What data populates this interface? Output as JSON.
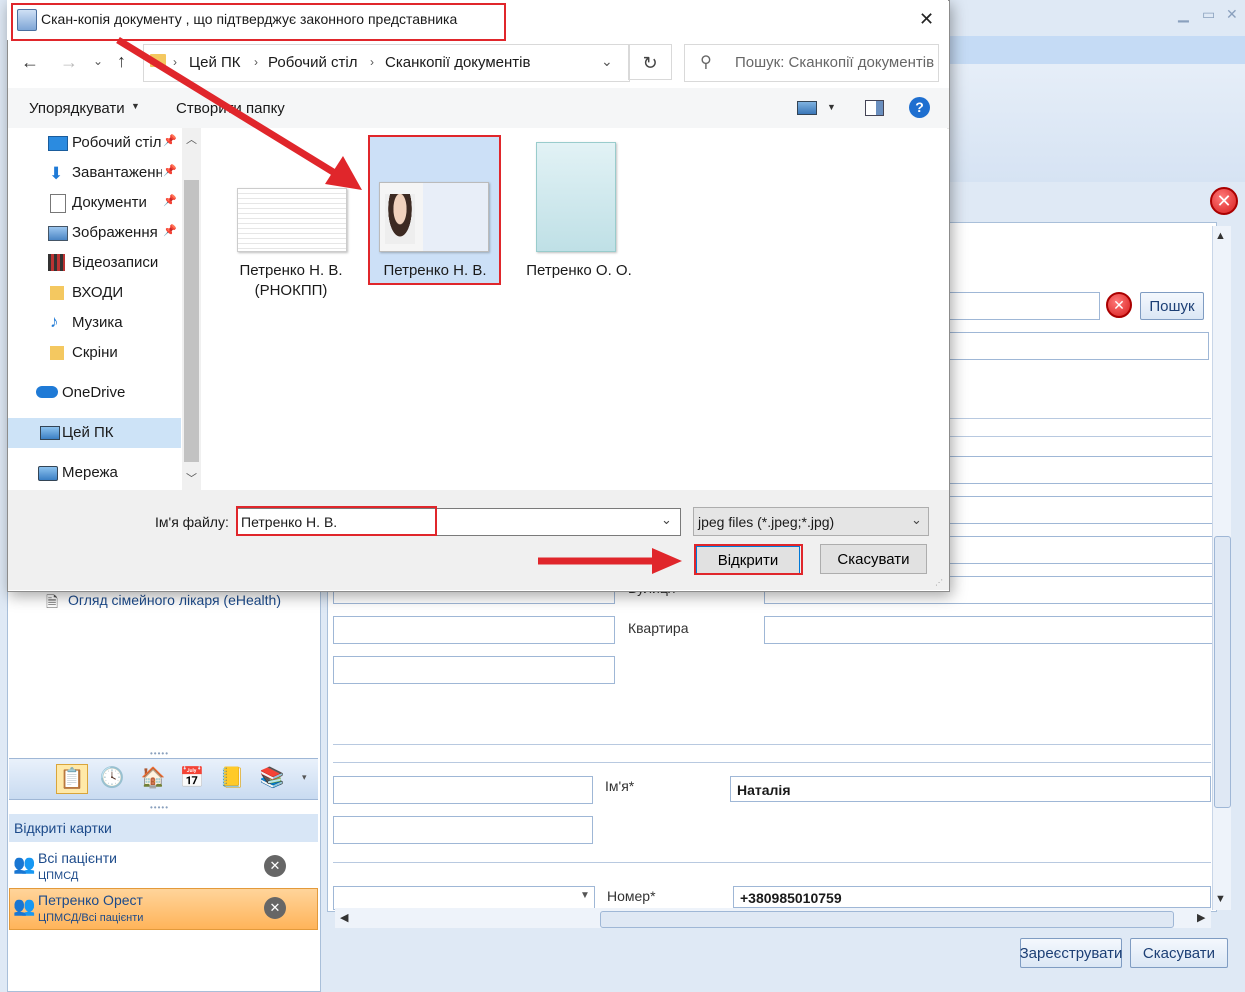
{
  "dialog": {
    "title": "Скан-копія документу , що підтверджує законного представника",
    "close_glyph": "✕",
    "breadcrumb": [
      "Цей ПК",
      "Робочий стіл",
      "Сканкопії документів"
    ],
    "search_placeholder": "Пошук: Сканкопії документів",
    "cmd": {
      "organize": "Упорядкувати",
      "new_folder": "Створити папку"
    },
    "nav": [
      {
        "label": "Робочий стіл",
        "icon": "desktop-icon",
        "pinned": true
      },
      {
        "label": "Завантаження",
        "icon": "download-icon",
        "pinned": true
      },
      {
        "label": "Документи",
        "icon": "documents-icon",
        "pinned": true
      },
      {
        "label": "Зображення",
        "icon": "pictures-icon",
        "pinned": true
      },
      {
        "label": "Відеозаписи",
        "icon": "videos-icon",
        "pinned": false
      },
      {
        "label": "ВХОДИ",
        "icon": "folder-icon",
        "pinned": false
      },
      {
        "label": "Музика",
        "icon": "music-icon",
        "pinned": false
      },
      {
        "label": "Скріни",
        "icon": "folder-icon",
        "pinned": false
      },
      {
        "label": "OneDrive",
        "icon": "cloud-icon",
        "pinned": false
      },
      {
        "label": "Цей ПК",
        "icon": "computer-icon",
        "pinned": false
      },
      {
        "label": "Мережа",
        "icon": "network-icon",
        "pinned": false
      }
    ],
    "files": [
      {
        "line1": "Петренко Н. В.",
        "line2": "(РНОКПП)"
      },
      {
        "line1": "Петренко Н. В.",
        "line2": ""
      },
      {
        "line1": "Петренко О. О.",
        "line2": ""
      }
    ],
    "filename_label": "Ім'я файлу:",
    "filename_value": "Петренко Н. В.",
    "filetype_value": "jpeg files (*.jpeg;*.jpg)",
    "open_button": "Відкрити",
    "cancel_button": "Скасувати"
  },
  "app": {
    "search_button": "Пошук",
    "tree_item": "Огляд сімейного лікаря (eHealth)",
    "open_cards_header": "Відкриті картки",
    "cards": [
      {
        "title": "Всі пацієнти",
        "subtitle": "ЦПМСД"
      },
      {
        "title": "Петренко Орест",
        "subtitle": "ЦПМСД/Всі пацієнти"
      }
    ],
    "labels": {
      "street": "Вулиця",
      "apartment": "Квартира",
      "first_name": "Ім'я*",
      "number": "Номер*"
    },
    "values": {
      "first_name": "Наталія",
      "phone": "+380985010759"
    },
    "register_button": "Зареєструвати",
    "cancel_button": "Скасувати"
  },
  "colors": {
    "highlight_red": "#e0262b",
    "accent_blue": "#1c4a8a",
    "selected_card": "#ffc27a"
  }
}
